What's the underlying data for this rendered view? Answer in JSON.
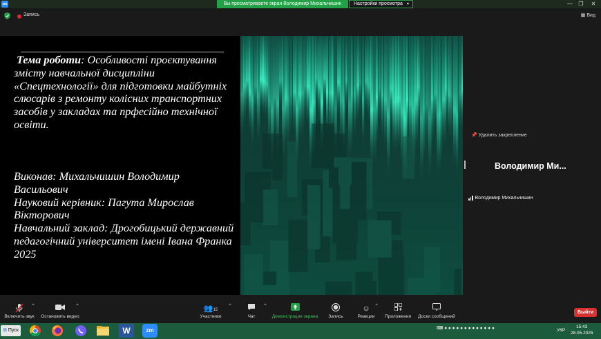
{
  "titlebar": {
    "app_logo": "zm",
    "share_banner": "Вы просматриваете экран Володимир Михальчишин",
    "view_options": "Настройки просмотра",
    "view_options_chevron": "▾",
    "minimize": "—",
    "restore": "❐",
    "close": "✕"
  },
  "topbar": {
    "recording_label": "Запись",
    "view_label": "Вид",
    "view_icon": "view-grid-icon"
  },
  "slide": {
    "topic_label": "Тема роботи",
    "topic_text": ": Особливості проєктування змісту навчальної дисципліни «Спецтехнології» для підготовки майбутніх слюсарів з ремонту колісних транспортних засобів у закладах та прфесійно технічної освіти.",
    "author": "Виконав: Михальчишин Володимир Васильович",
    "supervisor": "Науковий керівник: Пагута Мирослав Вікторович",
    "institution": "Навчальний заклад: Дрогобицький державний педагогічний університет імені Івана Франка",
    "year": "2025"
  },
  "side_panel": {
    "unpin_label": "Удалить закрепление",
    "speaker_name": "Володимир  Ми...",
    "speaker_tag": "Володимир Михальчишин"
  },
  "toolbar": {
    "mute_label": "Включить звук",
    "video_label": "Остановить видео",
    "participants_label": "Участники",
    "participants_count": "15",
    "chat_label": "Чат",
    "share_label": "Демонстрация экрана",
    "record_label": "Запись",
    "reactions_label": "Реакции",
    "apps_label": "Приложения",
    "whiteboards_label": "Доски сообщений",
    "leave_label": "Выйти",
    "colors": {
      "share": "#24a148",
      "leave": "#d93030"
    }
  },
  "taskbar": {
    "start_label": "Пуск",
    "apps": [
      "chrome-icon",
      "firefox-icon",
      "viber-icon",
      "explorer-icon",
      "word-icon",
      "zoom-icon"
    ],
    "zoom_label": "zm",
    "word_label": "W",
    "language": "УКР",
    "time": "15:43",
    "date": "28.05.2025"
  }
}
